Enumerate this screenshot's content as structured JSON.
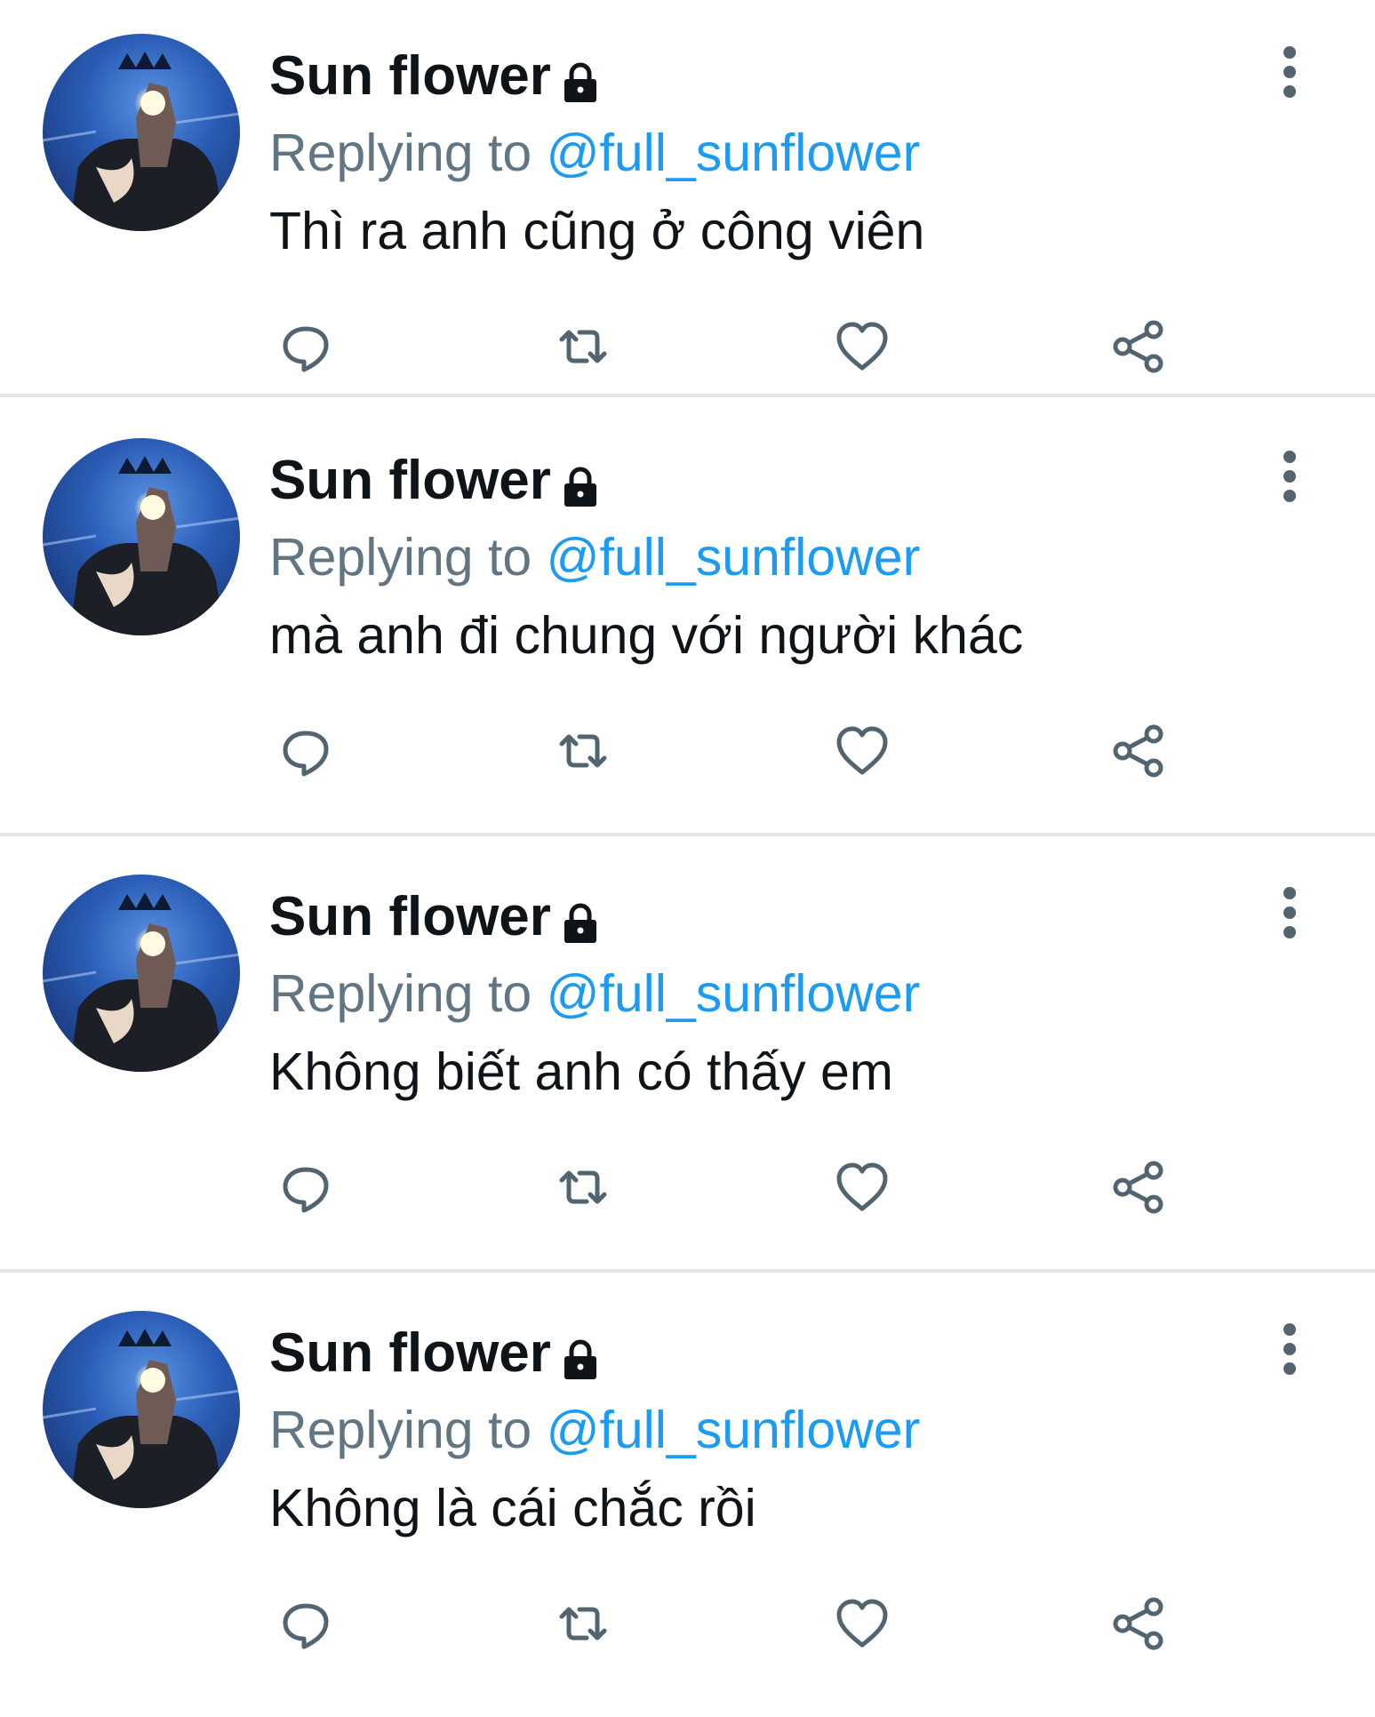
{
  "tweets": [
    {
      "author_name": "Sun flower",
      "reply_prefix": "Replying to",
      "reply_handle": "@full_sunflower",
      "text": "Thì ra anh cũng ở công viên",
      "locked_icon": "lock-icon"
    },
    {
      "author_name": "Sun flower",
      "reply_prefix": "Replying to",
      "reply_handle": "@full_sunflower",
      "text": "mà anh đi chung với người khác",
      "locked_icon": "lock-icon"
    },
    {
      "author_name": "Sun flower",
      "reply_prefix": "Replying to",
      "reply_handle": "@full_sunflower",
      "text": "Không biết anh có thấy em",
      "locked_icon": "lock-icon"
    },
    {
      "author_name": "Sun flower",
      "reply_prefix": "Replying to",
      "reply_handle": "@full_sunflower",
      "text": "Không là cái chắc rồi",
      "locked_icon": "lock-icon"
    }
  ],
  "icons": {
    "reply": "reply-icon",
    "retweet": "retweet-icon",
    "like": "heart-icon",
    "share": "share-icon",
    "more": "more-options-icon"
  },
  "colors": {
    "handle": "#1d9bf0",
    "secondary_text": "#627583",
    "icon": "#536471",
    "divider": "#e3e6e8"
  }
}
